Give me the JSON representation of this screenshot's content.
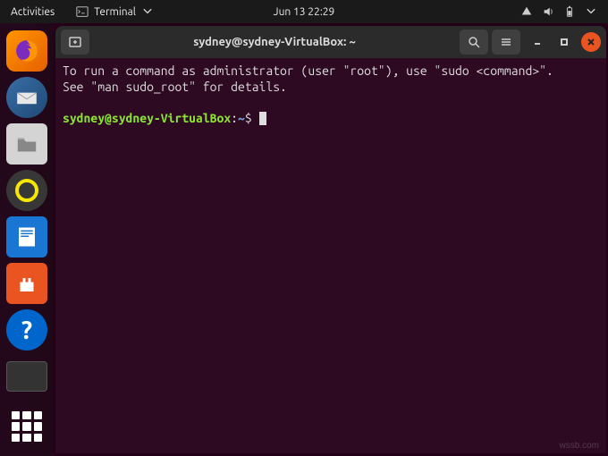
{
  "topbar": {
    "activities": "Activities",
    "app_label": "Terminal",
    "datetime": "Jun 13  22:29"
  },
  "dock": {
    "firefox": "firefox",
    "thunderbird": "thunderbird",
    "files": "files",
    "rhythmbox": "rhythmbox",
    "writer": "libreoffice-writer",
    "software": "ubuntu-software",
    "help": "help",
    "help_symbol": "?",
    "tray": "minimized-item",
    "apps": "show-applications"
  },
  "terminal": {
    "title": "sydney@sydney-VirtualBox: ~",
    "motd_line1": "To run a command as administrator (user \"root\"), use \"sudo <command>\".",
    "motd_line2": "See \"man sudo_root\" for details.",
    "prompt_user": "sydney@sydney-VirtualBox",
    "prompt_colon": ":",
    "prompt_path": "~",
    "prompt_symbol": "$"
  },
  "watermark": "wssb.com"
}
